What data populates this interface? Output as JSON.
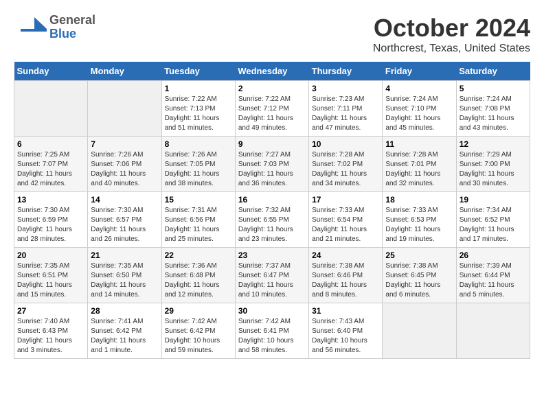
{
  "header": {
    "logo_general": "General",
    "logo_blue": "Blue",
    "title": "October 2024",
    "subtitle": "Northcrest, Texas, United States"
  },
  "days_of_week": [
    "Sunday",
    "Monday",
    "Tuesday",
    "Wednesday",
    "Thursday",
    "Friday",
    "Saturday"
  ],
  "weeks": [
    [
      {
        "day": "",
        "info": ""
      },
      {
        "day": "",
        "info": ""
      },
      {
        "day": "1",
        "info": "Sunrise: 7:22 AM\nSunset: 7:13 PM\nDaylight: 11 hours and 51 minutes."
      },
      {
        "day": "2",
        "info": "Sunrise: 7:22 AM\nSunset: 7:12 PM\nDaylight: 11 hours and 49 minutes."
      },
      {
        "day": "3",
        "info": "Sunrise: 7:23 AM\nSunset: 7:11 PM\nDaylight: 11 hours and 47 minutes."
      },
      {
        "day": "4",
        "info": "Sunrise: 7:24 AM\nSunset: 7:10 PM\nDaylight: 11 hours and 45 minutes."
      },
      {
        "day": "5",
        "info": "Sunrise: 7:24 AM\nSunset: 7:08 PM\nDaylight: 11 hours and 43 minutes."
      }
    ],
    [
      {
        "day": "6",
        "info": "Sunrise: 7:25 AM\nSunset: 7:07 PM\nDaylight: 11 hours and 42 minutes."
      },
      {
        "day": "7",
        "info": "Sunrise: 7:26 AM\nSunset: 7:06 PM\nDaylight: 11 hours and 40 minutes."
      },
      {
        "day": "8",
        "info": "Sunrise: 7:26 AM\nSunset: 7:05 PM\nDaylight: 11 hours and 38 minutes."
      },
      {
        "day": "9",
        "info": "Sunrise: 7:27 AM\nSunset: 7:03 PM\nDaylight: 11 hours and 36 minutes."
      },
      {
        "day": "10",
        "info": "Sunrise: 7:28 AM\nSunset: 7:02 PM\nDaylight: 11 hours and 34 minutes."
      },
      {
        "day": "11",
        "info": "Sunrise: 7:28 AM\nSunset: 7:01 PM\nDaylight: 11 hours and 32 minutes."
      },
      {
        "day": "12",
        "info": "Sunrise: 7:29 AM\nSunset: 7:00 PM\nDaylight: 11 hours and 30 minutes."
      }
    ],
    [
      {
        "day": "13",
        "info": "Sunrise: 7:30 AM\nSunset: 6:59 PM\nDaylight: 11 hours and 28 minutes."
      },
      {
        "day": "14",
        "info": "Sunrise: 7:30 AM\nSunset: 6:57 PM\nDaylight: 11 hours and 26 minutes."
      },
      {
        "day": "15",
        "info": "Sunrise: 7:31 AM\nSunset: 6:56 PM\nDaylight: 11 hours and 25 minutes."
      },
      {
        "day": "16",
        "info": "Sunrise: 7:32 AM\nSunset: 6:55 PM\nDaylight: 11 hours and 23 minutes."
      },
      {
        "day": "17",
        "info": "Sunrise: 7:33 AM\nSunset: 6:54 PM\nDaylight: 11 hours and 21 minutes."
      },
      {
        "day": "18",
        "info": "Sunrise: 7:33 AM\nSunset: 6:53 PM\nDaylight: 11 hours and 19 minutes."
      },
      {
        "day": "19",
        "info": "Sunrise: 7:34 AM\nSunset: 6:52 PM\nDaylight: 11 hours and 17 minutes."
      }
    ],
    [
      {
        "day": "20",
        "info": "Sunrise: 7:35 AM\nSunset: 6:51 PM\nDaylight: 11 hours and 15 minutes."
      },
      {
        "day": "21",
        "info": "Sunrise: 7:35 AM\nSunset: 6:50 PM\nDaylight: 11 hours and 14 minutes."
      },
      {
        "day": "22",
        "info": "Sunrise: 7:36 AM\nSunset: 6:48 PM\nDaylight: 11 hours and 12 minutes."
      },
      {
        "day": "23",
        "info": "Sunrise: 7:37 AM\nSunset: 6:47 PM\nDaylight: 11 hours and 10 minutes."
      },
      {
        "day": "24",
        "info": "Sunrise: 7:38 AM\nSunset: 6:46 PM\nDaylight: 11 hours and 8 minutes."
      },
      {
        "day": "25",
        "info": "Sunrise: 7:38 AM\nSunset: 6:45 PM\nDaylight: 11 hours and 6 minutes."
      },
      {
        "day": "26",
        "info": "Sunrise: 7:39 AM\nSunset: 6:44 PM\nDaylight: 11 hours and 5 minutes."
      }
    ],
    [
      {
        "day": "27",
        "info": "Sunrise: 7:40 AM\nSunset: 6:43 PM\nDaylight: 11 hours and 3 minutes."
      },
      {
        "day": "28",
        "info": "Sunrise: 7:41 AM\nSunset: 6:42 PM\nDaylight: 11 hours and 1 minute."
      },
      {
        "day": "29",
        "info": "Sunrise: 7:42 AM\nSunset: 6:42 PM\nDaylight: 10 hours and 59 minutes."
      },
      {
        "day": "30",
        "info": "Sunrise: 7:42 AM\nSunset: 6:41 PM\nDaylight: 10 hours and 58 minutes."
      },
      {
        "day": "31",
        "info": "Sunrise: 7:43 AM\nSunset: 6:40 PM\nDaylight: 10 hours and 56 minutes."
      },
      {
        "day": "",
        "info": ""
      },
      {
        "day": "",
        "info": ""
      }
    ]
  ]
}
